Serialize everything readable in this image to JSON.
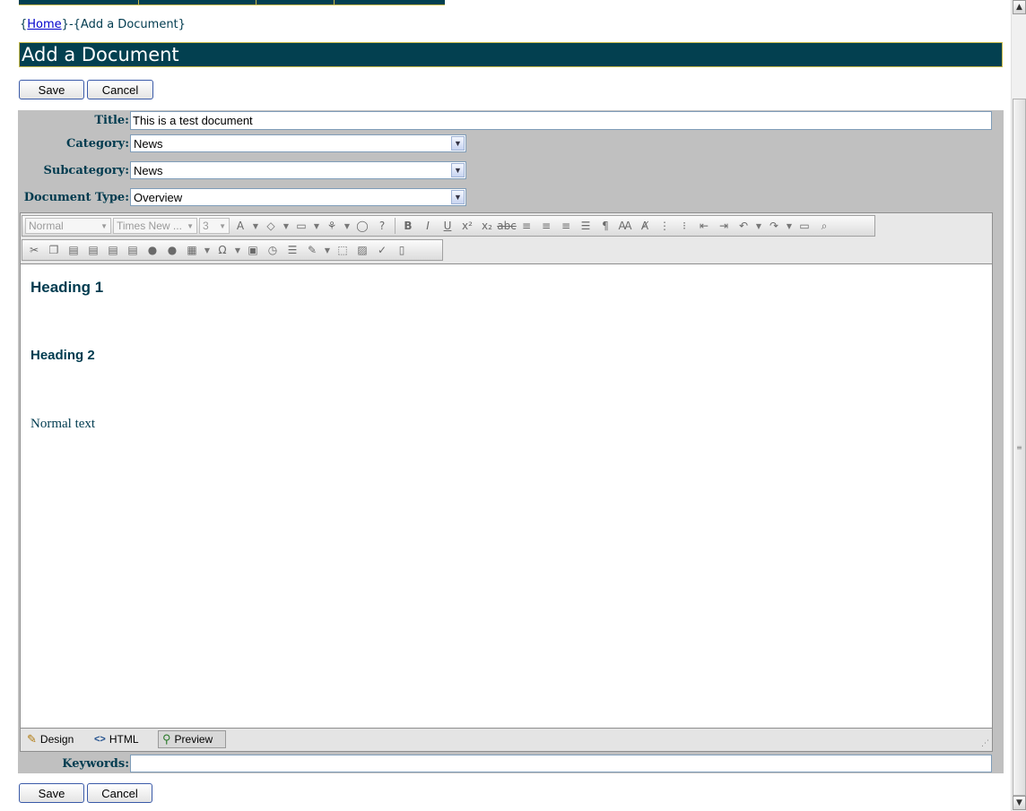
{
  "breadcrumb": {
    "open1": "{",
    "home": "Home",
    "sep": "}-{",
    "current": "Add a Document",
    "close": "}"
  },
  "page_title": "Add a Document",
  "buttons": {
    "save": "Save",
    "cancel": "Cancel"
  },
  "form": {
    "title_label": "Title:",
    "title_value": "This is a test document",
    "category_label": "Category:",
    "category_value": "News",
    "subcategory_label": "Subcategory:",
    "subcategory_value": "News",
    "doctype_label": "Document Type:",
    "doctype_value": "Overview",
    "keywords_label": "Keywords:",
    "keywords_value": ""
  },
  "editor": {
    "format_dropdown": "Normal",
    "font_dropdown": "Times New ...",
    "size_dropdown": "3",
    "content": {
      "heading1": "Heading 1",
      "heading2": "Heading 2",
      "normal": "Normal text"
    },
    "modes": {
      "design": "Design",
      "html": "HTML",
      "preview": "Preview"
    }
  }
}
